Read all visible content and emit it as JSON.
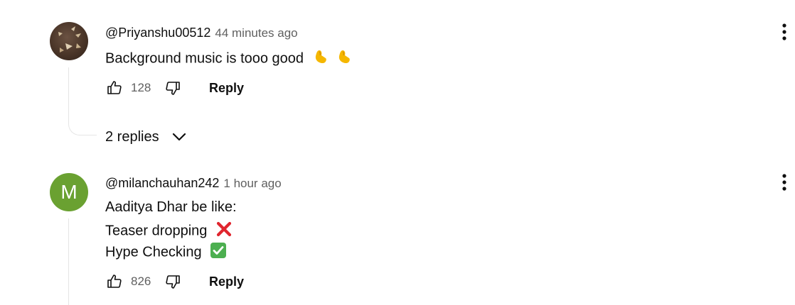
{
  "comments": [
    {
      "author": "@Priyanshu00512",
      "time": "44 minutes ago",
      "lines": [
        "Background music is tooo good"
      ],
      "emoji": [
        "pinched-fingers-emoji",
        "pinched-fingers-emoji"
      ],
      "likes": "128",
      "reply_label": "Reply",
      "replies_label": "2 replies"
    },
    {
      "author": "@milanchauhan242",
      "time": "1 hour ago",
      "avatar_letter": "M",
      "lines": [
        "Aaditya Dhar be like:",
        "Teaser dropping",
        "Hype Checking"
      ],
      "emoji": [
        "cross-mark-emoji",
        "check-mark-button-emoji"
      ],
      "likes": "826",
      "reply_label": "Reply"
    }
  ],
  "colors": {
    "avatar_green": "#6aa131",
    "secondary_text": "#606060",
    "cross_red": "#e0262f",
    "check_green": "#4caf50",
    "pinch_yellow": "#f5b700"
  },
  "icons": [
    "thumb-up-icon",
    "thumb-down-icon",
    "chevron-down-icon",
    "more-vert-icon"
  ]
}
